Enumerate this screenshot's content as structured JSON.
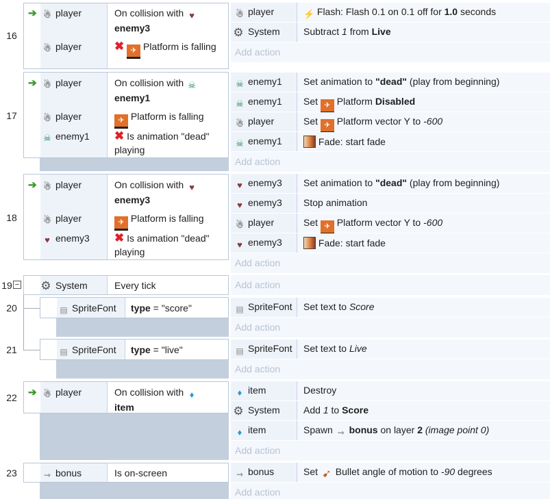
{
  "events": [
    {
      "num": "16",
      "conditions": [
        {
          "obj": "player",
          "icon": "player-icon",
          "pre": "On collision with",
          "bold": "enemy3",
          "picon": "enemy3-icon"
        },
        {
          "obj": "player",
          "icon": "player-icon",
          "text": "Platform is falling",
          "inverted": true
        }
      ],
      "actions": [
        {
          "obj": "player",
          "icon": "player-icon",
          "a": "Flash: Flash 0.1 on 0.1 off for ",
          "b": "1.0",
          "c": " seconds"
        },
        {
          "obj": "System",
          "icon": "gear-icon",
          "a": "Subtract ",
          "i": "1",
          "c": " from ",
          "b": "Live"
        }
      ]
    },
    {
      "num": "17"
    },
    {
      "num": "18"
    },
    {
      "num": "19"
    },
    {
      "num": "20"
    },
    {
      "num": "21"
    },
    {
      "num": "22"
    },
    {
      "num": "23"
    }
  ],
  "e16": {
    "num": "16",
    "c1_obj": "player",
    "c1_pre": "On collision with",
    "c1_bold": "enemy3",
    "c2_obj": "player",
    "c2_text": "Platform is falling",
    "a1_obj": "player",
    "a1_pre": "Flash: Flash 0.1 on 0.1 off for ",
    "a1_bold": "1.0",
    "a1_post": " seconds",
    "a2_obj": "System",
    "a2_pre": "Subtract ",
    "a2_it": "1",
    "a2_mid": " from ",
    "a2_bold": "Live"
  },
  "e17": {
    "num": "17",
    "c1_obj": "player",
    "c1_pre": "On collision with",
    "c1_bold": "enemy1",
    "c2_obj": "player",
    "c2_text": "Platform is falling",
    "c3_obj": "enemy1",
    "c3_text": "Is animation \"dead\" playing",
    "a1_obj": "enemy1",
    "a1_pre": "Set animation to ",
    "a1_bold": "\"dead\"",
    "a1_post": " (play from beginning)",
    "a2_obj": "enemy1",
    "a2_pre": "Set ",
    "a2_mid": " Platform ",
    "a2_bold": "Disabled",
    "a3_obj": "player",
    "a3_pre": "Set ",
    "a3_mid": " Platform vector Y to ",
    "a3_it": "-600",
    "a4_obj": "enemy1",
    "a4_text": "Fade: start fade"
  },
  "e18": {
    "num": "18",
    "c1_obj": "player",
    "c1_pre": "On collision with",
    "c1_bold": "enemy3",
    "c2_obj": "player",
    "c2_text": "Platform is falling",
    "c3_obj": "enemy3",
    "c3_text": "Is animation \"dead\" playing",
    "a1_obj": "enemy3",
    "a1_pre": "Set animation to ",
    "a1_bold": "\"dead\"",
    "a1_post": " (play from beginning)",
    "a2_obj": "enemy3",
    "a2_text": "Stop animation",
    "a3_obj": "player",
    "a3_pre": "Set ",
    "a3_mid": " Platform vector Y to ",
    "a3_it": "-600",
    "a4_obj": "enemy3",
    "a4_text": "Fade: start fade"
  },
  "e19": {
    "num": "19",
    "collapse": "−",
    "c1_obj": "System",
    "c1_text": "Every tick"
  },
  "e20": {
    "num": "20",
    "c1_obj": "SpriteFont",
    "c1_bold": "type",
    "c1_post": " = \"score\"",
    "a1_obj": "SpriteFont",
    "a1_pre": "Set text to ",
    "a1_it": "Score"
  },
  "e21": {
    "num": "21",
    "c1_obj": "SpriteFont",
    "c1_bold": "type",
    "c1_post": " = \"live\"",
    "a1_obj": "SpriteFont",
    "a1_pre": "Set text to ",
    "a1_it": "Live"
  },
  "e22": {
    "num": "22",
    "c1_obj": "player",
    "c1_pre": "On collision with",
    "c1_bold": "item",
    "a1_obj": "item",
    "a1_text": "Destroy",
    "a2_obj": "System",
    "a2_pre": "Add ",
    "a2_it": "1",
    "a2_mid": " to ",
    "a2_bold": "Score",
    "a3_obj": "item",
    "a3_pre": "Spawn ",
    "a3_bold": "bonus",
    "a3_mid": " on layer ",
    "a3_bold2": "2",
    "a3_it": " (image point 0)"
  },
  "e23": {
    "num": "23",
    "c1_obj": "bonus",
    "c1_text": "Is on-screen",
    "a1_obj": "bonus",
    "a1_pre": "Set ",
    "a1_mid": " Bullet angle of motion to ",
    "a1_it": "-90",
    "a1_post": " degrees"
  },
  "add_action_label": "Add action"
}
